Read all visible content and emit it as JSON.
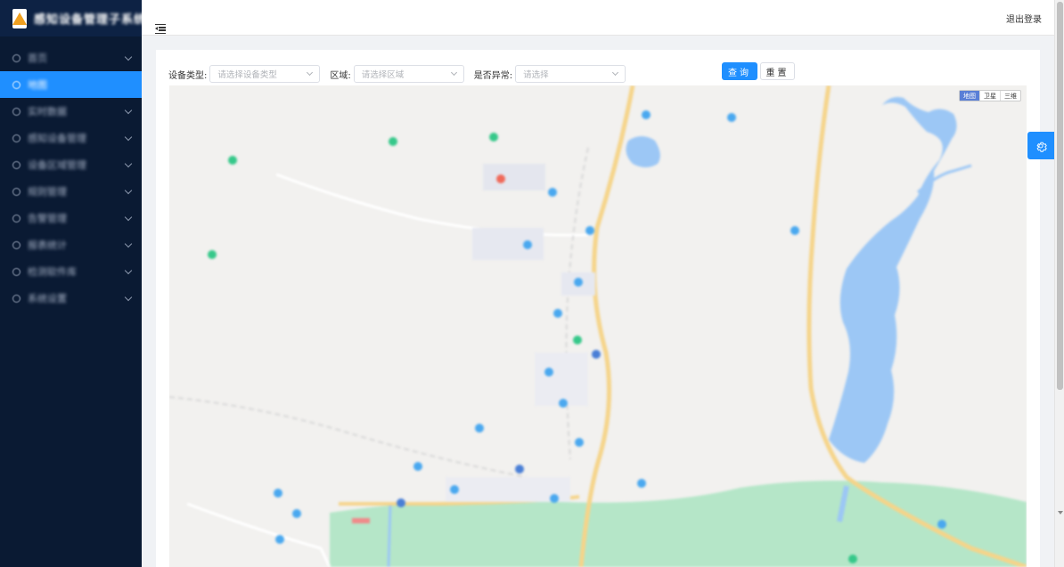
{
  "app": {
    "title": "感知设备管理子系统"
  },
  "sidebar": {
    "items": [
      {
        "label": "首页",
        "has_children": true
      },
      {
        "label": "地图",
        "has_children": false,
        "active": true
      },
      {
        "label": "实时数据",
        "has_children": true
      },
      {
        "label": "感知设备管理",
        "has_children": true
      },
      {
        "label": "设备区域管理",
        "has_children": true
      },
      {
        "label": "规则管理",
        "has_children": true
      },
      {
        "label": "告警管理",
        "has_children": true
      },
      {
        "label": "报表统计",
        "has_children": true
      },
      {
        "label": "检测软件库",
        "has_children": true
      },
      {
        "label": "系统设置",
        "has_children": true
      }
    ]
  },
  "header": {
    "logout": "退出登录"
  },
  "filters": {
    "device_type_label": "设备类型:",
    "device_type_placeholder": "请选择设备类型",
    "area_label": "区域:",
    "area_placeholder": "请选择区域",
    "abnormal_label": "是否异常:",
    "abnormal_placeholder": "请选择"
  },
  "buttons": {
    "query": "查询",
    "reset": "重置"
  },
  "map": {
    "types": [
      "地图",
      "卫星",
      "三维"
    ],
    "colors": {
      "land": "#f2f1ef",
      "water": "#9cc7f5",
      "park": "#b5e6c8",
      "road": "#f5d48a",
      "marker_blue": "#4aa8ef",
      "marker_green": "#36c88a",
      "marker_red": "#f06a5a"
    }
  }
}
